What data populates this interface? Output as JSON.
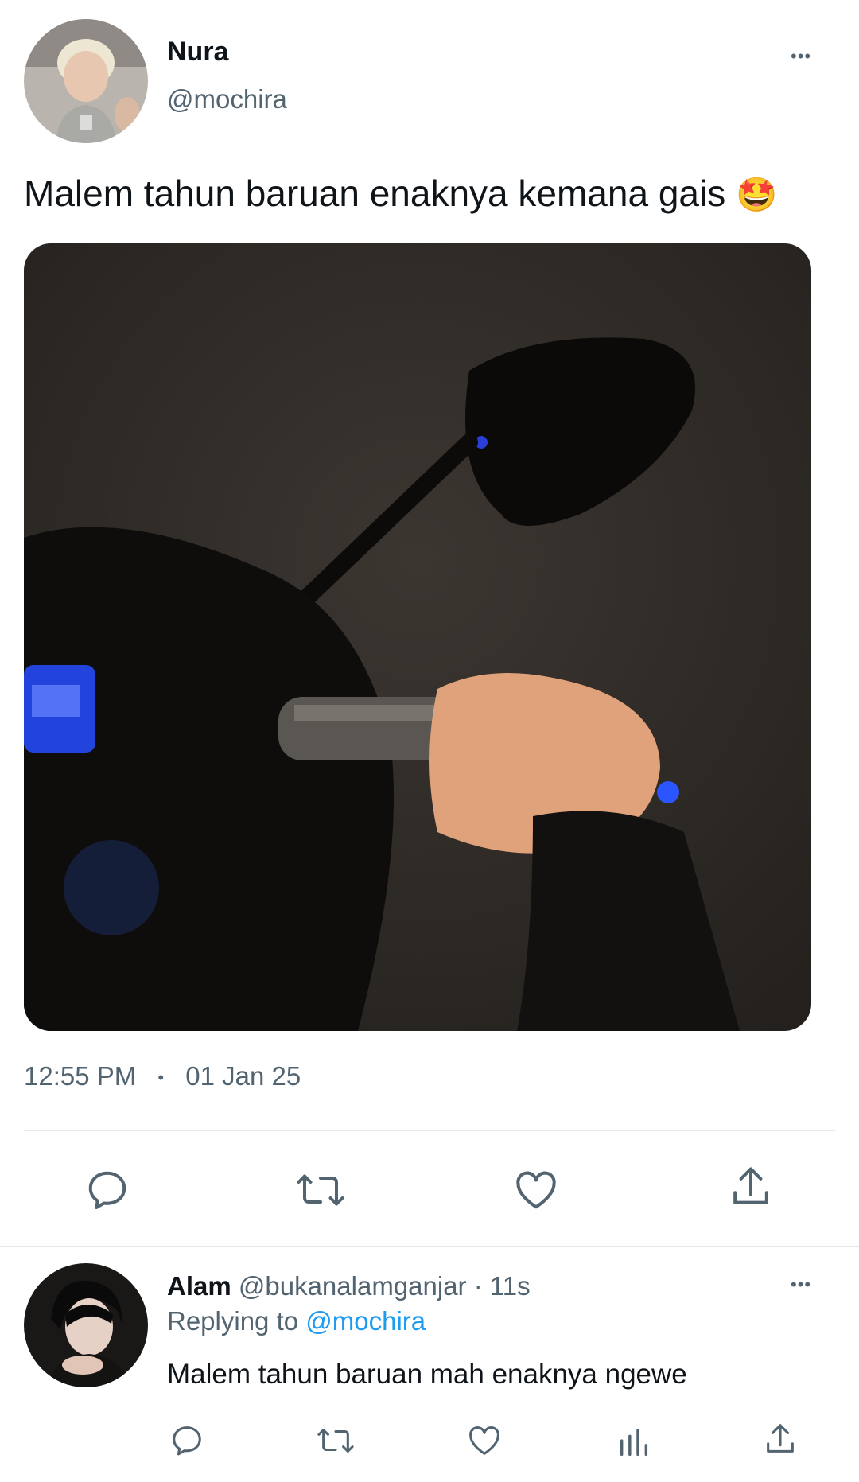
{
  "tweet": {
    "author_name": "Nura",
    "author_handle": "@mochira",
    "text": "Malem tahun baruan enaknya kemana gais",
    "emoji": "🤩",
    "time": "12:55 PM",
    "separator": "•",
    "date": "01 Jan 25",
    "more_label": "•••"
  },
  "reply": {
    "author_name": "Alam",
    "author_handle": "@bukanalamganjar",
    "dot": "·",
    "age": "11s",
    "replying_prefix": "Replying to",
    "replying_handle": "@mochira",
    "text": "Malem tahun baruan mah enaknya ngewe",
    "more_label": "•••"
  },
  "icons": {
    "tweet_actions": [
      "reply-icon",
      "retweet-icon",
      "like-icon",
      "share-icon"
    ],
    "reply_actions": [
      "reply-icon",
      "retweet-icon",
      "like-icon",
      "analytics-icon",
      "share-icon"
    ]
  },
  "colors": {
    "text": "#0f1419",
    "muted": "#536471",
    "link": "#1d9bf0",
    "divider": "#e4e8eb"
  }
}
